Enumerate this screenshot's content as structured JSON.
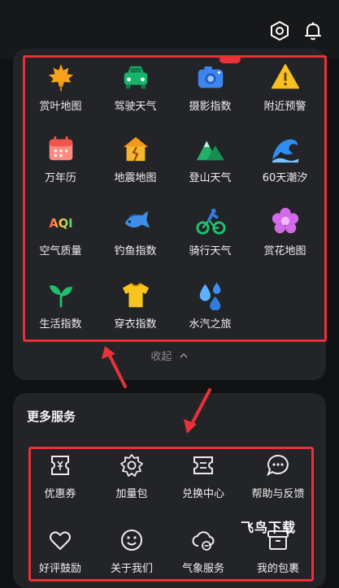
{
  "services": [
    {
      "label": "赏叶地图",
      "icon": "maple-leaf-icon"
    },
    {
      "label": "驾驶天气",
      "icon": "car-icon"
    },
    {
      "label": "摄影指数",
      "icon": "camera-icon",
      "badge": "new"
    },
    {
      "label": "附近预警",
      "icon": "warning-icon"
    },
    {
      "label": "万年历",
      "icon": "calendar-icon"
    },
    {
      "label": "地震地图",
      "icon": "house-crack-icon"
    },
    {
      "label": "登山天气",
      "icon": "mountain-icon"
    },
    {
      "label": "60天潮汐",
      "icon": "wave-icon"
    },
    {
      "label": "空气质量",
      "icon": "aqi-icon",
      "icon_text": "AQI"
    },
    {
      "label": "钓鱼指数",
      "icon": "fish-icon"
    },
    {
      "label": "骑行天气",
      "icon": "cyclist-icon"
    },
    {
      "label": "赏花地图",
      "icon": "flower-icon"
    },
    {
      "label": "生活指数",
      "icon": "sprout-icon"
    },
    {
      "label": "穿衣指数",
      "icon": "tshirt-icon"
    },
    {
      "label": "水汽之旅",
      "icon": "water-drops-icon"
    }
  ],
  "collapse_label": "收起",
  "more_services": {
    "title": "更多服务",
    "items": [
      {
        "label": "优惠券",
        "icon": "coupon-icon"
      },
      {
        "label": "加量包",
        "icon": "gear-badge-icon"
      },
      {
        "label": "兑换中心",
        "icon": "ticket-icon"
      },
      {
        "label": "帮助与反馈",
        "icon": "chat-bubble-icon"
      },
      {
        "label": "好评鼓励",
        "icon": "heart-icon"
      },
      {
        "label": "关于我们",
        "icon": "smiley-icon"
      },
      {
        "label": "气象服务",
        "icon": "cloud-minus-icon"
      },
      {
        "label": "我的包裹",
        "icon": "package-icon"
      }
    ]
  },
  "watermark": "飞鸟下载",
  "colors": {
    "annotation": "#e8323a",
    "card": "#232427",
    "background": "#111214"
  }
}
